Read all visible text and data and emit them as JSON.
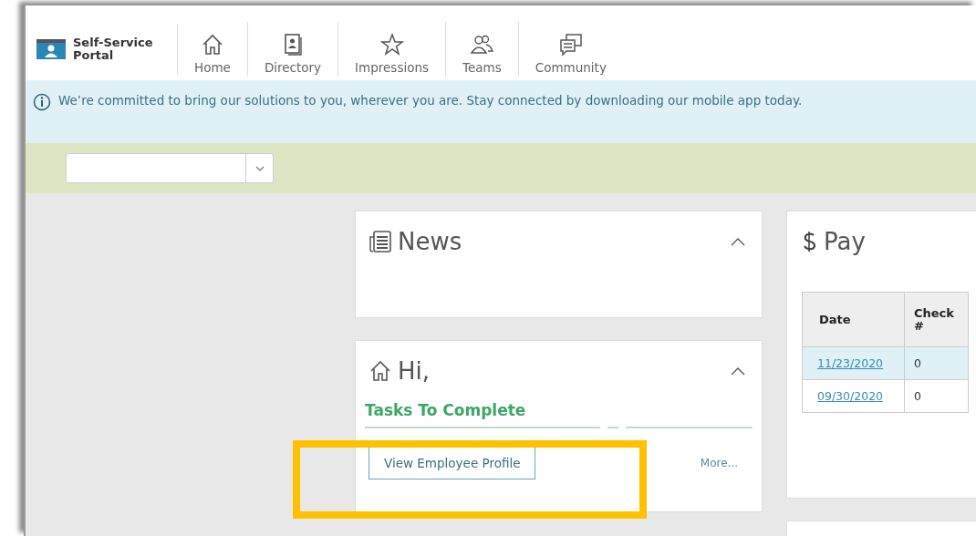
{
  "portal": {
    "title": "Self-Service Portal"
  },
  "nav": [
    {
      "label": "Home",
      "kind": "home"
    },
    {
      "label": "Directory",
      "kind": "directory"
    },
    {
      "label": "Impressions",
      "kind": "star"
    },
    {
      "label": "Teams",
      "kind": "people"
    },
    {
      "label": "Community",
      "kind": "chat"
    }
  ],
  "info_banner": {
    "text": "We’re committed to bring our solutions to you, wherever you are. Stay connected by downloading our mobile app today."
  },
  "news": {
    "title": "News",
    "expanded": true
  },
  "welcome": {
    "title": "Hi,",
    "expanded": true,
    "section": "Tasks To Complete",
    "button": "View Employee Profile",
    "link": "More..."
  },
  "pay": {
    "title": "Pay",
    "table": {
      "columns": [
        "Date",
        "Check #"
      ],
      "rows": [
        {
          "cells": [
            "11/23/2020",
            "0"
          ],
          "selected": true
        },
        {
          "cells": [
            "09/30/2020",
            "0"
          ],
          "selected": false
        }
      ]
    }
  }
}
